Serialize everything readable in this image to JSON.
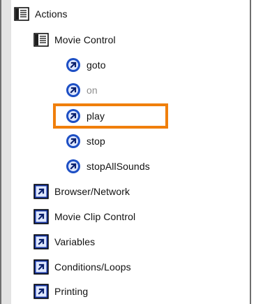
{
  "tree": {
    "root": {
      "label": "Actions",
      "icon": "book-icon"
    },
    "movie_control": {
      "label": "Movie Control",
      "icon": "book-icon",
      "items": [
        {
          "label": "goto",
          "icon": "action-arrow-icon",
          "enabled": true
        },
        {
          "label": "on",
          "icon": "action-arrow-icon",
          "enabled": false
        },
        {
          "label": "play",
          "icon": "action-arrow-icon",
          "enabled": true,
          "highlighted": true
        },
        {
          "label": "stop",
          "icon": "action-arrow-icon",
          "enabled": true
        },
        {
          "label": "stopAllSounds",
          "icon": "action-arrow-icon",
          "enabled": true
        }
      ]
    },
    "categories": [
      {
        "label": "Browser/Network",
        "icon": "category-arrow-icon"
      },
      {
        "label": "Movie Clip Control",
        "icon": "category-arrow-icon"
      },
      {
        "label": "Variables",
        "icon": "category-arrow-icon"
      },
      {
        "label": "Conditions/Loops",
        "icon": "category-arrow-icon"
      },
      {
        "label": "Printing",
        "icon": "category-arrow-icon"
      }
    ]
  },
  "colors": {
    "highlight": "#f07f0c",
    "action_icon": "#1d4fc4",
    "category_icon": "#1b3aa6",
    "frame": "#6f6f6f",
    "gutter": "#e3e3e3"
  }
}
